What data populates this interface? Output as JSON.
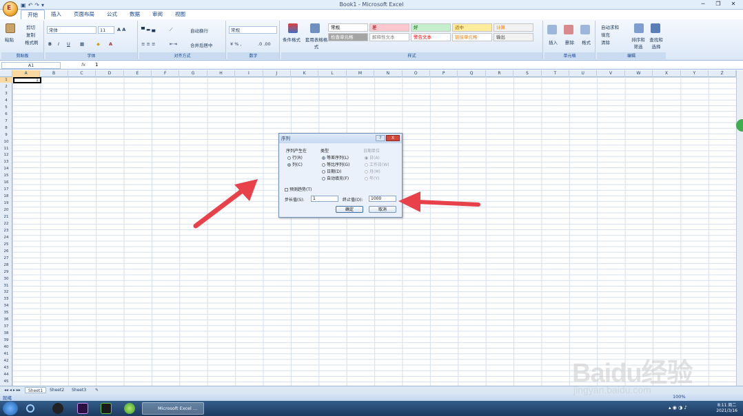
{
  "window": {
    "title": "Book1 - Microsoft Excel"
  },
  "office_button": {
    "label": "E"
  },
  "tabs": [
    "开始",
    "插入",
    "页面布局",
    "公式",
    "数据",
    "审阅",
    "视图"
  ],
  "ribbon": {
    "clipboard": {
      "paste": "粘贴",
      "cut": "剪切",
      "copy": "复制",
      "format_painter": "格式刷",
      "label": "剪贴板"
    },
    "font": {
      "name": "宋体",
      "size": "11",
      "label": "字体"
    },
    "alignment": {
      "wrap": "自动换行",
      "merge": "合并后居中",
      "label": "对齐方式"
    },
    "number": {
      "format": "常规",
      "label": "数字"
    },
    "styles": {
      "conditional": "条件格式",
      "table": "套用表格格式",
      "cells": [
        {
          "text": "常规",
          "bg": "#ffffff",
          "fg": "#000000"
        },
        {
          "text": "差",
          "bg": "#ffc7ce",
          "fg": "#9c0006"
        },
        {
          "text": "好",
          "bg": "#c6efce",
          "fg": "#006100"
        },
        {
          "text": "适中",
          "bg": "#ffeb9c",
          "fg": "#9c5700"
        },
        {
          "text": "计算",
          "bg": "#f2f2f2",
          "fg": "#fa7d00"
        },
        {
          "text": "检查单元格",
          "bg": "#a5a5a5",
          "fg": "#ffffff"
        },
        {
          "text": "解释性文本",
          "bg": "#ffffff",
          "fg": "#7f7f7f"
        },
        {
          "text": "警告文本",
          "bg": "#ffffff",
          "fg": "#ff0000"
        },
        {
          "text": "链接单元格",
          "bg": "#ffffff",
          "fg": "#fa7d00"
        },
        {
          "text": "输出",
          "bg": "#f2f2f2",
          "fg": "#3f3f3f"
        }
      ],
      "label": "样式"
    },
    "cells_group": {
      "insert": "插入",
      "delete": "删除",
      "format": "格式",
      "label": "单元格"
    },
    "editing": {
      "autosum": "自动求和",
      "fill": "填充",
      "clear": "清除",
      "sort": "排序和筛选",
      "find": "查找和选择",
      "label": "编辑"
    }
  },
  "formula_bar": {
    "name_box": "A1",
    "fx": "fx",
    "value": "1"
  },
  "columns": [
    "A",
    "B",
    "C",
    "D",
    "E",
    "F",
    "G",
    "H",
    "I",
    "J",
    "K",
    "L",
    "M",
    "N",
    "O",
    "P",
    "Q",
    "R",
    "S",
    "T",
    "U",
    "V",
    "W",
    "X",
    "Y",
    "Z"
  ],
  "rows": [
    "1",
    "2",
    "3",
    "4",
    "5",
    "6",
    "7",
    "8",
    "9",
    "10",
    "11",
    "12",
    "13",
    "14",
    "15",
    "16",
    "17",
    "18",
    "19",
    "20",
    "21",
    "22",
    "23",
    "24",
    "25",
    "26",
    "27",
    "28",
    "29",
    "30",
    "31",
    "32",
    "33",
    "34",
    "35",
    "36",
    "37",
    "38",
    "39",
    "40",
    "41",
    "42",
    "43",
    "44",
    "45"
  ],
  "cell_a1": "1",
  "sheets": [
    "Sheet1",
    "Sheet2",
    "Sheet3"
  ],
  "status": {
    "mode": "就绪",
    "zoom": "100%"
  },
  "dialog": {
    "title": "序列",
    "help": "?",
    "close": "X",
    "series_in": {
      "label": "序列产生在",
      "rows": "行(R)",
      "cols": "列(C)"
    },
    "type": {
      "label": "类型",
      "linear": "等差序列(L)",
      "growth": "等比序列(G)",
      "date": "日期(D)",
      "autofill": "自动填充(F)"
    },
    "date_unit": {
      "label": "日期单位",
      "day": "日(A)",
      "weekday": "工作日(W)",
      "month": "月(M)",
      "year": "年(Y)"
    },
    "trend": "预测趋势(T)",
    "step_label": "步长值(S):",
    "step_value": "1",
    "stop_label": "终止值(O):",
    "stop_value": "1000",
    "ok": "确定",
    "cancel": "取消"
  },
  "taskbar": {
    "app": "Microsoft Excel ...",
    "time": "8:11 周二",
    "date": "2021/3/16"
  },
  "watermark": {
    "line1": "Baidu经验",
    "line2": "jingyan.baidu.com"
  },
  "colors": {
    "arrow": "#e8414a",
    "ribbon": "#dbe7f7",
    "taskbar": "#1b3a5f"
  }
}
